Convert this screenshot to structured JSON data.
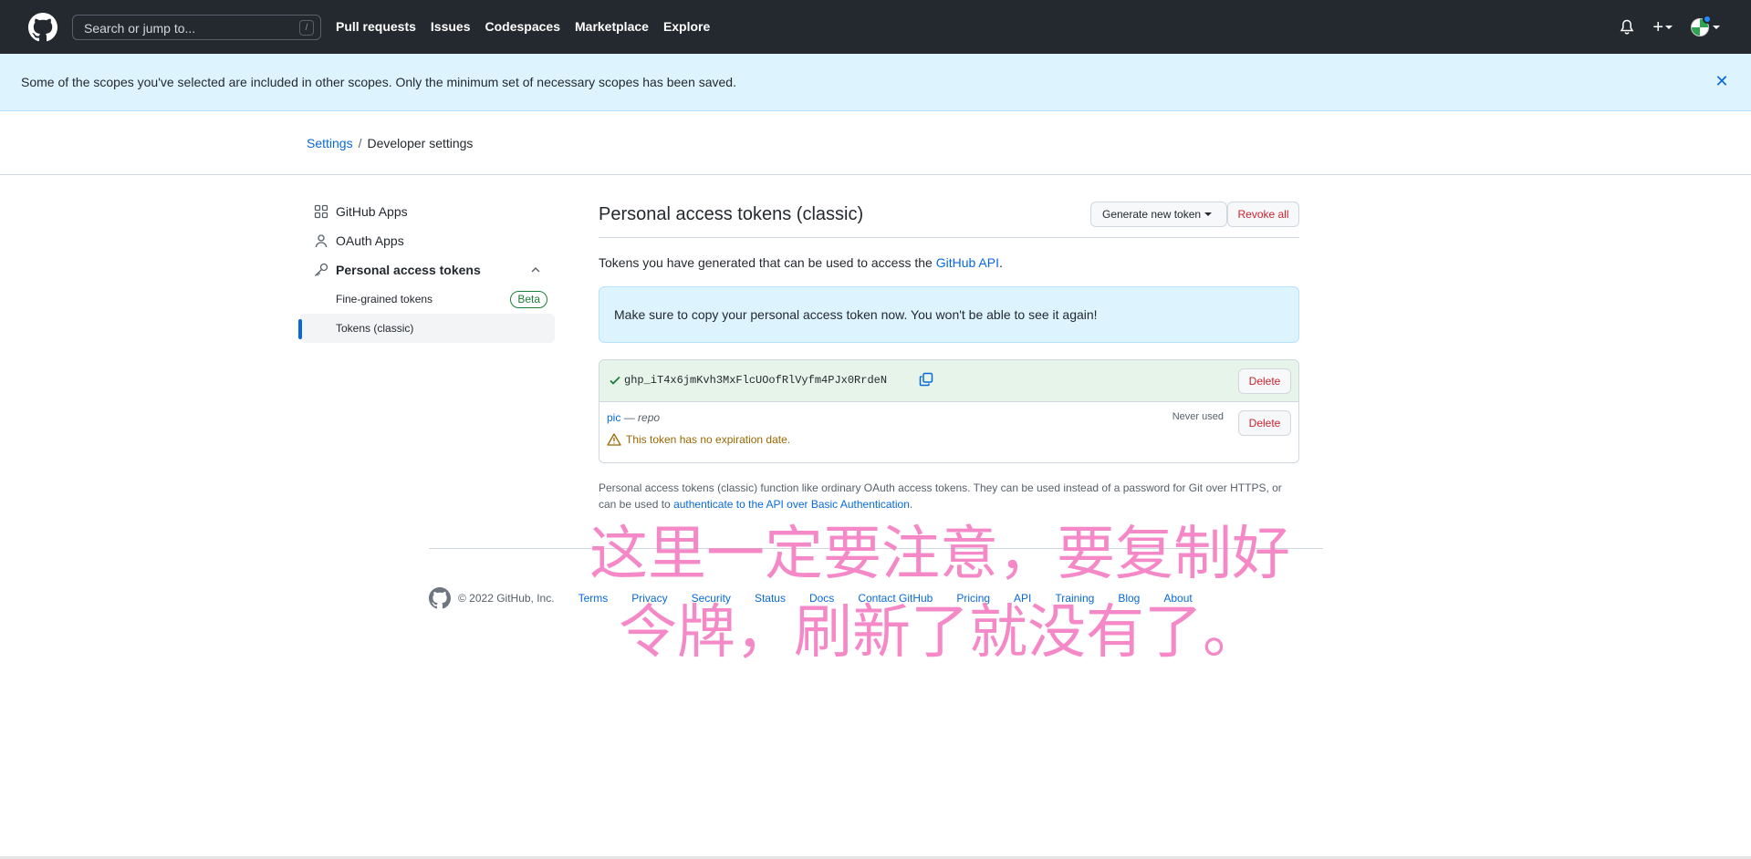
{
  "header": {
    "search_placeholder": "Search or jump to...",
    "search_shortcut": "/",
    "nav": [
      "Pull requests",
      "Issues",
      "Codespaces",
      "Marketplace",
      "Explore"
    ],
    "plus_label": "+"
  },
  "flash": {
    "message": "Some of the scopes you've selected are included in other scopes. Only the minimum set of necessary scopes has been saved.",
    "close_glyph": "✕"
  },
  "breadcrumb": {
    "settings": "Settings",
    "separator": "/",
    "current": "Developer settings"
  },
  "sidebar": {
    "github_apps": "GitHub Apps",
    "oauth_apps": "OAuth Apps",
    "personal_tokens": "Personal access tokens",
    "fine_grained": "Fine-grained tokens",
    "beta": "Beta",
    "classic": "Tokens (classic)"
  },
  "main": {
    "title": "Personal access tokens (classic)",
    "generate_btn": "Generate new token",
    "revoke_btn": "Revoke all",
    "intro_prefix": "Tokens you have generated that can be used to access the ",
    "intro_link": "GitHub API",
    "intro_suffix": ".",
    "notice": "Make sure to copy your personal access token now. You won't be able to see it again!",
    "new_token": "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",
    "delete": "Delete",
    "token_name": "pic",
    "token_sep": "—",
    "token_scope": "repo",
    "never_used": "Never used",
    "no_expiry": "This token has no expiration date.",
    "foot_prefix": "Personal access tokens (classic) function like ordinary OAuth access tokens. They can be used instead of a password for Git over HTTPS, or can be used to ",
    "foot_link": "authenticate to the API over Basic Authentication",
    "foot_suffix": "."
  },
  "footer": {
    "copyright": "© 2022 GitHub, Inc.",
    "links": [
      "Terms",
      "Privacy",
      "Security",
      "Status",
      "Docs",
      "Contact GitHub",
      "Pricing",
      "API",
      "Training",
      "Blog",
      "About"
    ]
  },
  "annotation": {
    "line1": "这里一定要注意，要复制好",
    "line2": "令牌，刷新了就没有了。"
  },
  "colors": {
    "header_bg": "#24292f",
    "accent": "#0969da",
    "danger": "#cf222e",
    "success": "#1a7f37",
    "annotation": "#f57fc4"
  }
}
